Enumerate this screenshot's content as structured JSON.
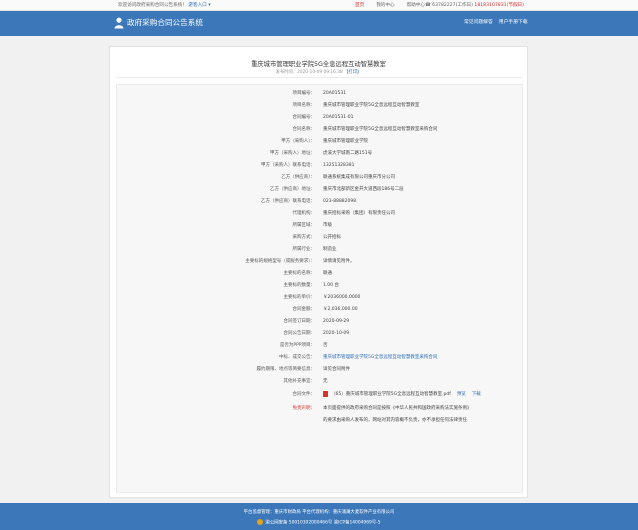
{
  "topbar": {
    "greeting": "欢迎访问政府采购合同公告系统！",
    "user_label": "游客入口",
    "user_chevron": "▾",
    "links": [
      {
        "label": "首页",
        "highlight": true
      },
      {
        "label": "我的中心",
        "highlight": false
      },
      {
        "label": "帮助中心",
        "highlight": false
      }
    ],
    "phone_prefix": "☎ 63782227(工作日)",
    "phone_highlight": "18183107831(节假日)"
  },
  "header": {
    "system_name": "政府采购合同公告系统",
    "nav": [
      "常见问题解答",
      "用户手册下载"
    ]
  },
  "notice": {
    "title": "重庆城市管理职业学院5G全息远程互动智慧教室",
    "publish_prefix": "发布时间：2020-10-09 09:16:38",
    "print_label": "【打印】"
  },
  "fields": [
    {
      "label": "项目编号：",
      "value": "20A01531",
      "style": "normal"
    },
    {
      "label": "项目名称：",
      "value": "重庆城市管理职业学院5G全息远程互动智慧教室",
      "style": "normal"
    },
    {
      "label": "合同编号：",
      "value": "20A01531-01",
      "style": "normal"
    },
    {
      "label": "合同名称：",
      "value": "重庆城市管理职业学院5G全息远程互动智慧教室采购合同",
      "style": "normal"
    },
    {
      "label": "甲方（采购人）：",
      "value": "重庆城市管理职业学院",
      "style": "normal"
    },
    {
      "label": "甲方（采购人）地址：",
      "value": "虎溪大学城南二路151号",
      "style": "normal"
    },
    {
      "label": "甲方（采购人）联系电话：",
      "value": "13251328381",
      "style": "normal"
    },
    {
      "label": "乙方（供应商）：",
      "value": "联通系统集成有限公司重庆市分公司",
      "style": "normal"
    },
    {
      "label": "乙方（供应商）地址：",
      "value": "重庆市北部新区金开大道西段186号二层",
      "style": "normal"
    },
    {
      "label": "乙方（供应商）联系电话：",
      "value": "023-88882098",
      "style": "normal"
    },
    {
      "label": "代理机构：",
      "value": "重庆招标采购（集团）有限责任公司",
      "style": "normal"
    },
    {
      "label": "所属区域：",
      "value": "市级",
      "style": "normal"
    },
    {
      "label": "采购方式：",
      "value": "公开招标",
      "style": "normal"
    },
    {
      "label": "所属行业：",
      "value": "制造业",
      "style": "normal"
    },
    {
      "label": "主要标的规格型号（或服务要求）：",
      "value": "详情请见附件。",
      "style": "normal"
    },
    {
      "label": "主要标的名称：",
      "value": "联通",
      "style": "normal"
    },
    {
      "label": "主要标的数量：",
      "value": "1.00 台",
      "style": "normal"
    },
    {
      "label": "主要标的单价：",
      "value": "￥2036000.0000",
      "style": "normal"
    },
    {
      "label": "合同金额：",
      "value": "￥2,036,000.00",
      "style": "normal"
    },
    {
      "label": "合同签订日期：",
      "value": "2020-09-29",
      "style": "normal"
    },
    {
      "label": "合同公告日期：",
      "value": "2020-10-09",
      "style": "normal"
    },
    {
      "label": "是否为PPP项目：",
      "value": "否",
      "style": "normal"
    },
    {
      "label": "中标、成交公告：",
      "value": "重庆城市管理职业学院5G全息远程互动智慧教室采购合同",
      "style": "link"
    },
    {
      "label": "履约期限、地点等简要信息：",
      "value": "详见合同附件",
      "style": "normal"
    },
    {
      "label": "其他补充事宜：",
      "value": "无",
      "style": "normal"
    }
  ],
  "attachment": {
    "label": "合同文件：",
    "file_name": "（65）重庆城市管理职业学院5G全息远程互动智慧教室.pdf",
    "preview_label": "预览",
    "download_label": "下载",
    "icon": "pdf-icon"
  },
  "disclaimer": {
    "label": "免责声明：",
    "line1": "本页面提供的政府采购合同是按照《中华人民共和国政府采购法实施条例》",
    "line2": "的要求由采购人发布的，网站对其内容概不负责，亦不承担任何法律责任"
  },
  "footer": {
    "line1": "平台监督管理：重庆市财政局    平台代理机构：重庆涌澜大麦软件产业有限公司",
    "line2": "渝公网安备 50010302000466号    渝ICP备14004969号-5"
  },
  "colors": {
    "brand": "#3b77b9",
    "link": "#2b6cb7",
    "alert": "#d9312c"
  }
}
